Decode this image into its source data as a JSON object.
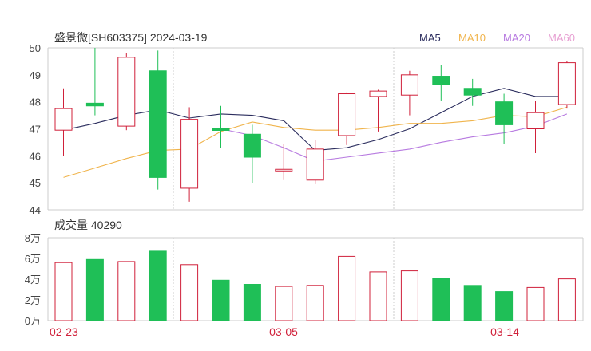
{
  "header": {
    "title": "盛景微[SH603375] 2024-03-19"
  },
  "legend": [
    {
      "label": "MA5",
      "color": "#2b2d5e"
    },
    {
      "label": "MA10",
      "color": "#f0b44c"
    },
    {
      "label": "MA20",
      "color": "#b77ae0"
    },
    {
      "label": "MA60",
      "color": "#e79fd2"
    }
  ],
  "volume_panel": {
    "title": "成交量 40290"
  },
  "colors": {
    "up": "#d0203a",
    "down": "#1fbf57",
    "grid": "#cccccc",
    "axis": "#444444"
  },
  "chart_data": [
    {
      "type": "candlestick",
      "title": "盛景微[SH603375] 2024-03-19",
      "ylim": [
        44,
        50
      ],
      "yticks": [
        "50",
        "49",
        "48",
        "47",
        "46",
        "45",
        "44"
      ],
      "xticks": [
        "02-23",
        "03-05",
        "03-14"
      ],
      "candles": [
        {
          "open": 46.95,
          "close": 47.75,
          "high": 48.5,
          "low": 46.0
        },
        {
          "open": 47.95,
          "close": 47.85,
          "high": 50.0,
          "low": 47.5
        },
        {
          "open": 47.1,
          "close": 49.65,
          "high": 49.8,
          "low": 46.95
        },
        {
          "open": 49.15,
          "close": 45.2,
          "high": 49.9,
          "low": 44.75
        },
        {
          "open": 44.8,
          "close": 47.35,
          "high": 47.8,
          "low": 44.3
        },
        {
          "open": 47.0,
          "close": 46.95,
          "high": 47.85,
          "low": 46.3
        },
        {
          "open": 46.8,
          "close": 45.95,
          "high": 47.15,
          "low": 45.0
        },
        {
          "open": 45.45,
          "close": 45.5,
          "high": 46.45,
          "low": 45.1
        },
        {
          "open": 45.1,
          "close": 46.25,
          "high": 46.6,
          "low": 44.95
        },
        {
          "open": 46.75,
          "close": 48.3,
          "high": 48.35,
          "low": 46.4
        },
        {
          "open": 48.2,
          "close": 48.4,
          "high": 48.45,
          "low": 46.9
        },
        {
          "open": 48.25,
          "close": 49.0,
          "high": 49.15,
          "low": 47.5
        },
        {
          "open": 48.95,
          "close": 48.65,
          "high": 49.35,
          "low": 48.05
        },
        {
          "open": 48.5,
          "close": 48.25,
          "high": 48.85,
          "low": 47.85
        },
        {
          "open": 48.0,
          "close": 47.15,
          "high": 48.3,
          "low": 46.45
        },
        {
          "open": 47.0,
          "close": 47.6,
          "high": 48.05,
          "low": 46.1
        },
        {
          "open": 47.9,
          "close": 49.45,
          "high": 49.5,
          "low": 47.75
        }
      ],
      "series": [
        {
          "name": "MA5",
          "values": [
            46.95,
            47.2,
            47.5,
            47.7,
            47.4,
            47.55,
            47.5,
            47.3,
            46.2,
            46.3,
            46.6,
            47.0,
            47.6,
            48.2,
            48.5,
            48.2,
            48.2
          ]
        },
        {
          "name": "MA10",
          "values": [
            45.2,
            45.55,
            45.9,
            46.2,
            46.25,
            46.9,
            47.25,
            47.05,
            46.95,
            46.95,
            47.05,
            47.2,
            47.2,
            47.3,
            47.5,
            47.45,
            47.8
          ]
        },
        {
          "name": "MA20",
          "values": [
            null,
            null,
            null,
            null,
            null,
            47.0,
            46.75,
            46.3,
            45.8,
            45.95,
            46.1,
            46.25,
            46.5,
            46.7,
            46.85,
            47.1,
            47.55
          ]
        }
      ]
    },
    {
      "type": "bar",
      "title": "成交量 40290",
      "ylim": [
        0,
        80000
      ],
      "yticks": [
        "8万",
        "6万",
        "4万",
        "2万",
        "0万"
      ],
      "values": [
        56000,
        59000,
        57000,
        67000,
        54000,
        39000,
        35000,
        33000,
        34000,
        62000,
        47000,
        48000,
        41000,
        34000,
        28000,
        32000,
        40290
      ]
    }
  ]
}
